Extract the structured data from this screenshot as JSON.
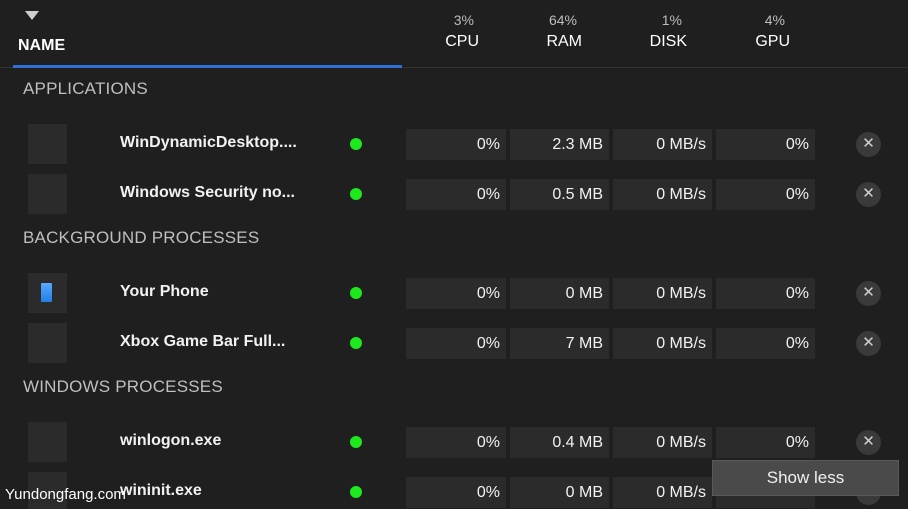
{
  "header": {
    "name_label": "NAME",
    "metrics": [
      {
        "label": "CPU",
        "percent": "3%"
      },
      {
        "label": "RAM",
        "percent": "64%"
      },
      {
        "label": "DISK",
        "percent": "1%"
      },
      {
        "label": "GPU",
        "percent": "4%"
      }
    ]
  },
  "sections": [
    {
      "title": "APPLICATIONS",
      "rows": [
        {
          "name": "WinDynamicDesktop....",
          "icon": "blank-app-icon",
          "cpu": "0%",
          "ram": "2.3 MB",
          "disk": "0 MB/s",
          "gpu": "0%"
        },
        {
          "name": "Windows Security no...",
          "icon": "blank-app-icon",
          "cpu": "0%",
          "ram": "0.5 MB",
          "disk": "0 MB/s",
          "gpu": "0%"
        }
      ]
    },
    {
      "title": "BACKGROUND PROCESSES",
      "rows": [
        {
          "name": "Your Phone",
          "icon": "phone-icon",
          "cpu": "0%",
          "ram": "0 MB",
          "disk": "0 MB/s",
          "gpu": "0%"
        },
        {
          "name": "Xbox Game Bar Full...",
          "icon": "blank-app-icon",
          "cpu": "0%",
          "ram": "7 MB",
          "disk": "0 MB/s",
          "gpu": "0%"
        }
      ]
    },
    {
      "title": "WINDOWS PROCESSES",
      "rows": [
        {
          "name": "winlogon.exe",
          "icon": "blank-app-icon",
          "cpu": "0%",
          "ram": "0.4 MB",
          "disk": "0 MB/s",
          "gpu": "0%"
        },
        {
          "name": "wininit.exe",
          "icon": "blank-app-icon",
          "cpu": "0%",
          "ram": "0 MB",
          "disk": "0 MB/s",
          "gpu": ""
        }
      ]
    }
  ],
  "close_glyph": "✕",
  "show_less_label": "Show less",
  "watermark": "Yundongfang.com",
  "colors": {
    "background": "#1f1f1f",
    "accent": "#2f6fd6",
    "status_running": "#1ee81e",
    "cell": "#2b2b2b"
  }
}
